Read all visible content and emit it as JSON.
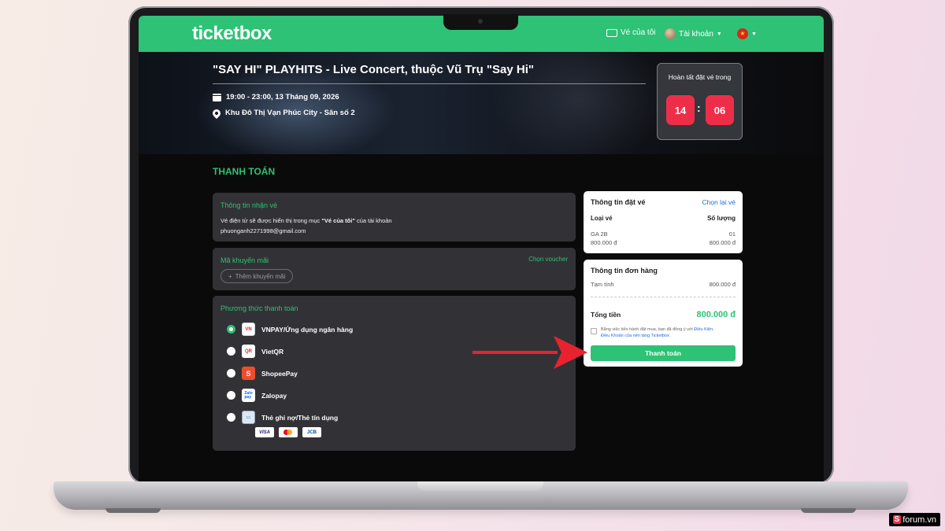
{
  "header": {
    "logo": "ticketbox",
    "my_tickets": "Vé của tôi",
    "account": "Tài khoản"
  },
  "event": {
    "title": "\"SAY HI\" PLAYHITS - Live Concert, thuộc Vũ Trụ \"Say Hi\"",
    "datetime": "19:00 - 23:00, 13 Tháng 09, 2026",
    "location": "Khu Đô Thị Vạn Phúc City - Sân số 2"
  },
  "countdown": {
    "label": "Hoàn tất đặt vé trong",
    "minutes": "14",
    "seconds": "06"
  },
  "checkout": {
    "section_title": "THANH TOÁN",
    "receive_info": {
      "title": "Thông tin nhận vé",
      "note_prefix": "Vé điện tử sẽ được hiển thị trong mục ",
      "note_highlight": "\"Vé của tôi\"",
      "note_suffix": " của tài khoản",
      "email": "phuonganh2271998@gmail.com"
    },
    "promo": {
      "title": "Mã khuyến mãi",
      "voucher_link": "Chọn voucher",
      "add_label": "Thêm khuyến mãi"
    },
    "payment": {
      "title": "Phương thức thanh toán",
      "methods": [
        {
          "name": "VNPAY/Ứng dụng ngân hàng",
          "selected": true
        },
        {
          "name": "VietQR",
          "selected": false
        },
        {
          "name": "ShopeePay",
          "selected": false
        },
        {
          "name": "Zalopay",
          "selected": false
        },
        {
          "name": "Thẻ ghi nợ/Thẻ tín dụng",
          "selected": false
        }
      ],
      "card_brands": [
        "VISA",
        "JCB"
      ]
    }
  },
  "ticket_info": {
    "title": "Thông tin đặt vé",
    "reselect": "Chọn lại vé",
    "col_type": "Loại vé",
    "col_qty": "Số lượng",
    "item_name": "GA 2B",
    "item_qty": "01",
    "item_price": "800.000 đ",
    "item_subtotal": "800.000 đ"
  },
  "order_info": {
    "title": "Thông tin đơn hàng",
    "subtotal_label": "Tạm tính",
    "subtotal_value": "800.000 đ",
    "total_label": "Tổng tiền",
    "total_value": "800.000 đ",
    "agree_text": "Bằng việc tiến hành đặt mua, bạn đã đồng ý với ",
    "agree_link": "Điều Kiện Giao Dịch Chung",
    "agree_link_short": "Điều Kiện,",
    "agree_link_2": "Điều Khoản của nền tảng Ticketbox",
    "pay_button": "Thanh toán"
  },
  "watermark": {
    "badge": "S",
    "text": "forum.vn"
  },
  "colors": {
    "brand_green": "#2dc275",
    "countdown_red": "#ee2e48",
    "panel_dark": "#323236",
    "arrow_red": "#e8232f"
  }
}
